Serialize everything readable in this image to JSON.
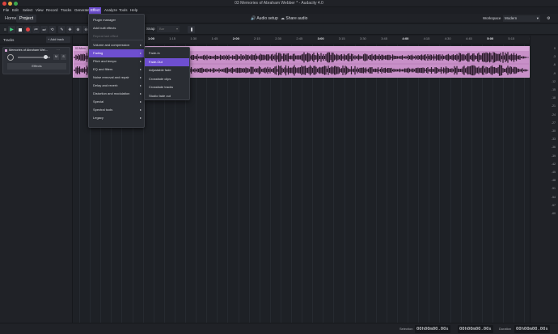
{
  "window": {
    "title": "03 Memories of Abraham Webber * - Audacity 4.0"
  },
  "menubar": {
    "items": [
      "File",
      "Edit",
      "Select",
      "View",
      "Record",
      "Tracks",
      "Generate",
      "Effect",
      "Analyze",
      "Tools",
      "Help"
    ],
    "active": "Effect"
  },
  "tabs": {
    "home": "Home",
    "project": "Project"
  },
  "header_actions": {
    "audio_setup": "Audio setup",
    "share_audio": "Share audio"
  },
  "workspace": {
    "label": "Workspace",
    "value": "Modern"
  },
  "toolbar": {
    "snap_label": "Snap",
    "snap_value": "Bar"
  },
  "tracks_panel": {
    "title": "Tracks",
    "add_label": "Add track",
    "track_name": "Memories of Abraham Wel...",
    "effects_label": "Effects"
  },
  "ruler": {
    "ticks": [
      "1:00",
      "1:15",
      "1:30",
      "1:45",
      "2:00",
      "2:15",
      "2:30",
      "2:45",
      "3:00",
      "3:15",
      "3:30",
      "3:45",
      "4:00",
      "4:15",
      "4:30",
      "4:45",
      "5:00",
      "5:15",
      "5:30"
    ]
  },
  "clip": {
    "name": "03 Mem..."
  },
  "db_scale": [
    "0",
    "-3",
    "-6",
    "-9",
    "-12",
    "-15",
    "-18",
    "-21",
    "-24",
    "-27",
    "-30",
    "-33",
    "-36",
    "-39",
    "-42",
    "-45",
    "-48",
    "-51",
    "-54",
    "-57",
    "-60"
  ],
  "effect_menu": {
    "items": [
      {
        "label": "Plugin manager",
        "sub": false
      },
      {
        "label": "Add built effects",
        "sub": false
      },
      {
        "label": "Repeat last effect",
        "sub": false,
        "disabled": true
      },
      {
        "label": "Volume and compression",
        "sub": true
      },
      {
        "label": "Fading",
        "sub": true,
        "highlight": true
      },
      {
        "label": "Pitch and tempo",
        "sub": true
      },
      {
        "label": "EQ and filters",
        "sub": true
      },
      {
        "label": "Noise removal and repair",
        "sub": true
      },
      {
        "label": "Delay and reverb",
        "sub": true
      },
      {
        "label": "Distortion and modulation",
        "sub": true
      },
      {
        "label": "Special",
        "sub": true
      },
      {
        "label": "Spectral tools",
        "sub": true
      },
      {
        "label": "Legacy",
        "sub": true
      }
    ]
  },
  "fading_menu": {
    "items": [
      {
        "label": "Fade-In"
      },
      {
        "label": "Fade-Out",
        "highlight": true
      },
      {
        "label": "Adjustable fade"
      },
      {
        "label": "Crossfade clips"
      },
      {
        "label": "Crossfade tracks"
      },
      {
        "label": "Studio fade out"
      }
    ]
  },
  "status": {
    "selection_label": "Selection",
    "sel_start": "00h00m00.00s",
    "sel_end": "00h00m00.00s",
    "duration_label": "Duration",
    "duration": "00h00m00.00s"
  },
  "colors": {
    "accent": "#6e4fd0",
    "clip": "#c890c8",
    "waveform": "#2a1a2a"
  }
}
